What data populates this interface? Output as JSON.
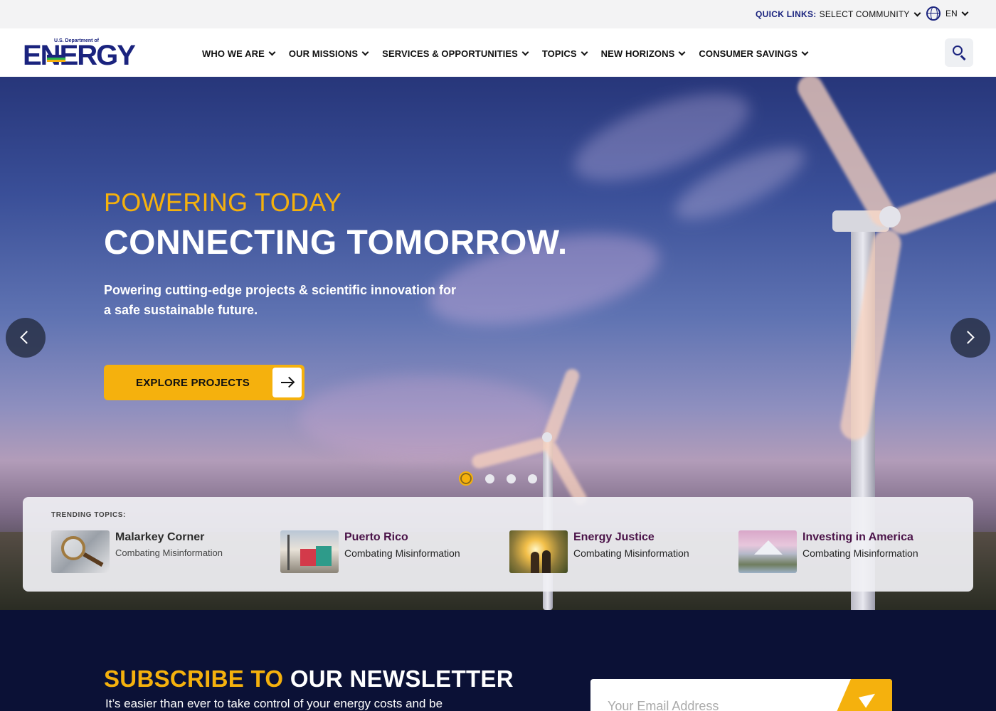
{
  "utility": {
    "quick_links_label": "QUICK LINKS:",
    "quick_links_value": "SELECT COMMUNITY",
    "language": "EN"
  },
  "logo": {
    "superscript": "U.S. Department of",
    "word": "ENERGY"
  },
  "nav": {
    "items": [
      {
        "label": "WHO WE ARE"
      },
      {
        "label": "OUR MISSIONS"
      },
      {
        "label": "SERVICES & OPPORTUNITIES"
      },
      {
        "label": "TOPICS"
      },
      {
        "label": "NEW HORIZONS"
      },
      {
        "label": "CONSUMER SAVINGS"
      }
    ]
  },
  "hero": {
    "kicker": "POWERING TODAY",
    "title": "CONNECTING TOMORROW.",
    "description": "Powering cutting-edge projects & scientific innovation for a safe sustainable future.",
    "cta_label": "EXPLORE PROJECTS",
    "active_slide": 1,
    "slide_count": 4
  },
  "trending": {
    "label": "TRENDING TOPICS:",
    "items": [
      {
        "title": "Malarkey Corner",
        "subtitle": "Combating Misinformation",
        "title_color": "#2b2b2b"
      },
      {
        "title": "Puerto Rico",
        "subtitle": "Combating Misinformation",
        "title_color": "#4a1248"
      },
      {
        "title": "Energy Justice",
        "subtitle": "Combating Misinformation",
        "title_color": "#4a1248"
      },
      {
        "title": "Investing in America",
        "subtitle": "Combating Misinformation",
        "title_color": "#4a1248"
      }
    ]
  },
  "newsletter": {
    "title_highlight": "SUBSCRIBE TO",
    "title_rest": "OUR NEWSLETTER",
    "description": "It’s easier than ever to take control of your energy costs and be",
    "email_placeholder": "Your Email Address"
  },
  "colors": {
    "brand_navy": "#1a237e",
    "accent_yellow": "#f5b10d",
    "newsletter_bg": "#0b1136"
  }
}
